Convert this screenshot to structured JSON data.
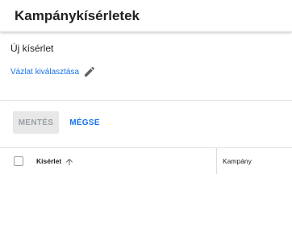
{
  "header": {
    "title": "Kampánykísérletek"
  },
  "experiment": {
    "name": "Új kísérlet",
    "draft_link": "Vázlat kiválasztása",
    "edit_icon": "pencil-icon"
  },
  "actions": {
    "save_label": "MENTÉS",
    "cancel_label": "MÉGSE"
  },
  "table": {
    "columns": [
      {
        "label": "Kísérlet",
        "sort": "ascending"
      },
      {
        "label": "Kampány"
      }
    ],
    "rows": []
  },
  "colors": {
    "link": "#1a73e8",
    "disabled_button_bg": "#e8e8e8",
    "disabled_button_text": "#9aa0a6"
  }
}
